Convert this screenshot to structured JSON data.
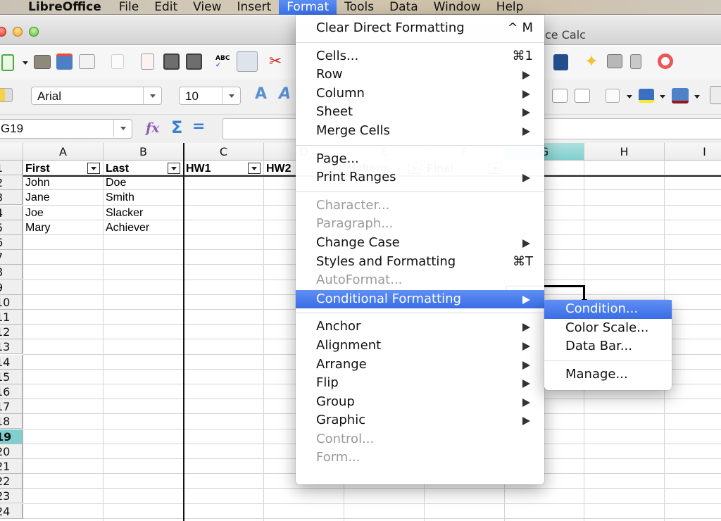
{
  "menubar": {
    "app": "LibreOffice",
    "items": [
      "File",
      "Edit",
      "View",
      "Insert",
      "Format",
      "Tools",
      "Data",
      "Window",
      "Help"
    ],
    "active": "Format"
  },
  "window": {
    "title_visible": "ce Calc"
  },
  "toolbar": {
    "standard_icons": [
      "new-spreadsheet-icon",
      "open-icon",
      "save-icon",
      "email-icon",
      "edit-file-icon",
      "export-pdf-icon",
      "print-icon",
      "print-preview-icon",
      "spellcheck-icon",
      "autospellcheck-icon",
      "cut-icon"
    ],
    "right_icons": [
      "draw-functions-icon",
      "navigator-icon",
      "gallery-icon",
      "data-sources-icon",
      "help-icon"
    ]
  },
  "formatting": {
    "font_name": "Arial",
    "font_size": "10",
    "right_icons": [
      "decrease-indent-icon",
      "increase-indent-icon",
      "borders-icon",
      "background-color-icon",
      "font-color-icon"
    ]
  },
  "formula_bar": {
    "name_box": "G19",
    "formula": ""
  },
  "sheet": {
    "columns": [
      "A",
      "B",
      "C",
      "D",
      "E",
      "F",
      "G",
      "H",
      "I"
    ],
    "selected_column": "G",
    "rows": [
      "1",
      "2",
      "3",
      "4",
      "5",
      "6",
      "7",
      "8",
      "9",
      "10",
      "11",
      "12",
      "13",
      "14",
      "15",
      "16",
      "17",
      "18",
      "19",
      "20",
      "21",
      "22",
      "23",
      "24"
    ],
    "selected_row": "19",
    "header_row": [
      "First",
      "Last",
      "HW1",
      "HW2",
      "Midterm",
      "Final"
    ],
    "data": [
      [
        "John",
        "Doe"
      ],
      [
        "Jane",
        "Smith"
      ],
      [
        "Joe",
        "Slacker"
      ],
      [
        "Mary",
        "Achiever"
      ]
    ]
  },
  "format_menu": {
    "items": [
      {
        "label": "Clear Direct Formatting",
        "shortcut": "^ M"
      },
      {
        "sep": true
      },
      {
        "label": "Cells...",
        "shortcut": "⌘1"
      },
      {
        "label": "Row",
        "submenu": true
      },
      {
        "label": "Column",
        "submenu": true
      },
      {
        "label": "Sheet",
        "submenu": true
      },
      {
        "label": "Merge Cells",
        "submenu": true
      },
      {
        "sep": true
      },
      {
        "label": "Page..."
      },
      {
        "label": "Print Ranges",
        "submenu": true
      },
      {
        "sep": true
      },
      {
        "label": "Character...",
        "disabled": true
      },
      {
        "label": "Paragraph...",
        "disabled": true
      },
      {
        "label": "Change Case",
        "submenu": true
      },
      {
        "label": "Styles and Formatting",
        "shortcut": "⌘T"
      },
      {
        "label": "AutoFormat...",
        "disabled": true
      },
      {
        "label": "Conditional Formatting",
        "submenu": true,
        "active": true
      },
      {
        "sep": true
      },
      {
        "label": "Anchor",
        "submenu": true
      },
      {
        "label": "Alignment",
        "submenu": true
      },
      {
        "label": "Arrange",
        "submenu": true
      },
      {
        "label": "Flip",
        "submenu": true
      },
      {
        "label": "Group",
        "submenu": true
      },
      {
        "label": "Graphic",
        "submenu": true
      },
      {
        "label": "Control...",
        "disabled": true
      },
      {
        "label": "Form...",
        "disabled": true
      }
    ]
  },
  "conditional_submenu": {
    "items": [
      {
        "label": "Condition...",
        "active": true
      },
      {
        "label": "Color Scale..."
      },
      {
        "label": "Data Bar..."
      },
      {
        "sep": true
      },
      {
        "label": "Manage..."
      }
    ]
  },
  "colors": {
    "menu_highlight": "#3a6de6",
    "selection_header": "#7fcfcf"
  }
}
